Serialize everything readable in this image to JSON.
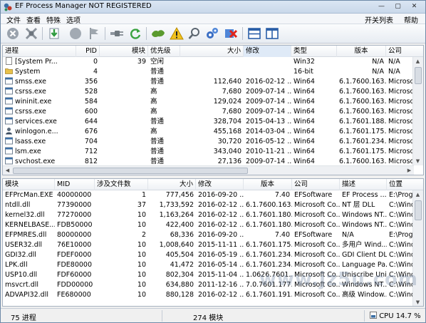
{
  "window": {
    "title": "EF Process Manager NOT REGISTERED",
    "controls": {
      "minimize": "—",
      "maximize": "▢",
      "close": "✕"
    }
  },
  "menu": {
    "file": "文件",
    "view": "查看",
    "special": "特殊",
    "options": "选项",
    "about": "开关列表",
    "help": "帮助"
  },
  "toolbar": {
    "icons": [
      "stop-icon",
      "kill-icon",
      "download-icon",
      "circle-icon",
      "flag-icon",
      "plug-icon",
      "refresh-icon",
      "map-icon",
      "warning-icon",
      "search-icon",
      "settings-icon",
      "error-icon",
      "layout-icon",
      "window-icon"
    ]
  },
  "processes": {
    "columns": [
      "进程",
      "PID",
      "模块",
      "优先级",
      "大小",
      "修改",
      "类型",
      "版本",
      "公司"
    ],
    "rows": [
      {
        "name": "[System Pr...",
        "pid": "0",
        "modules": "39",
        "priority": "空闲",
        "size": "",
        "modified": "",
        "type": "Win32",
        "version": "N/A",
        "company": "N/A",
        "icon": "blank"
      },
      {
        "name": "System",
        "pid": "4",
        "modules": "",
        "priority": "普通",
        "size": "",
        "modified": "",
        "type": "16-bit",
        "version": "N/A",
        "company": "N/A",
        "icon": "folder"
      },
      {
        "name": "smss.exe",
        "pid": "356",
        "modules": "",
        "priority": "普通",
        "size": "112,640",
        "modified": "2016-02-12 ...",
        "type": "Win64",
        "version": "6.1.7600.163...",
        "company": "Microsoft",
        "icon": "exe"
      },
      {
        "name": "csrss.exe",
        "pid": "528",
        "modules": "",
        "priority": "高",
        "size": "7,680",
        "modified": "2009-07-14 ...",
        "type": "Win64",
        "version": "6.1.7600.163...",
        "company": "Microsoft",
        "icon": "exe"
      },
      {
        "name": "wininit.exe",
        "pid": "584",
        "modules": "",
        "priority": "高",
        "size": "129,024",
        "modified": "2009-07-14 ...",
        "type": "Win64",
        "version": "6.1.7600.163...",
        "company": "Microsoft",
        "icon": "exe"
      },
      {
        "name": "csrss.exe",
        "pid": "600",
        "modules": "",
        "priority": "高",
        "size": "7,680",
        "modified": "2009-07-14 ...",
        "type": "Win64",
        "version": "6.1.7600.163...",
        "company": "Microsoft",
        "icon": "exe"
      },
      {
        "name": "services.exe",
        "pid": "644",
        "modules": "",
        "priority": "普通",
        "size": "328,704",
        "modified": "2015-04-13 ...",
        "type": "Win64",
        "version": "6.1.7601.188...",
        "company": "Microsoft",
        "icon": "exe"
      },
      {
        "name": "winlogon.e...",
        "pid": "676",
        "modules": "",
        "priority": "高",
        "size": "455,168",
        "modified": "2014-03-04 ...",
        "type": "Win64",
        "version": "6.1.7601.175...",
        "company": "Microsoft",
        "icon": "logon"
      },
      {
        "name": "lsass.exe",
        "pid": "704",
        "modules": "",
        "priority": "普通",
        "size": "30,720",
        "modified": "2016-05-12 ...",
        "type": "Win64",
        "version": "6.1.7601.234...",
        "company": "Microsoft",
        "icon": "exe"
      },
      {
        "name": "lsm.exe",
        "pid": "712",
        "modules": "",
        "priority": "普通",
        "size": "343,040",
        "modified": "2010-11-21 ...",
        "type": "Win64",
        "version": "6.1.7601.175...",
        "company": "Microsoft",
        "icon": "exe"
      },
      {
        "name": "svchost.exe",
        "pid": "812",
        "modules": "",
        "priority": "普通",
        "size": "27,136",
        "modified": "2009-07-14 ...",
        "type": "Win64",
        "version": "6.1.7600.163...",
        "company": "Microsoft",
        "icon": "exe"
      }
    ]
  },
  "modules": {
    "columns": [
      "模块",
      "MID",
      "涉及文件数",
      "大小",
      "修改",
      "版本",
      "公司",
      "描述",
      "位置"
    ],
    "rows": [
      {
        "name": "EFPrcMan.EXE",
        "mid": "40000000",
        "count": "1",
        "size": "777,456",
        "modified": "2016-09-20 ...",
        "version": "7.40",
        "company": "EFSoftware",
        "desc": "EF Process ...",
        "location": "E:\\Progra"
      },
      {
        "name": "ntdll.dll",
        "mid": "77390000",
        "count": "37",
        "size": "1,733,592",
        "modified": "2016-02-12 ...",
        "version": "6.1.7600.163...",
        "company": "Microsoft Co...",
        "desc": "NT 层 DLL",
        "location": "C:\\Window"
      },
      {
        "name": "kernel32.dll",
        "mid": "77270000",
        "count": "10",
        "size": "1,163,264",
        "modified": "2016-02-12 ...",
        "version": "6.1.7601.180...",
        "company": "Microsoft Co...",
        "desc": "Windows NT...",
        "location": "C:\\Window"
      },
      {
        "name": "KERNELBASE....",
        "mid": "FDB50000",
        "count": "10",
        "size": "422,400",
        "modified": "2016-02-12 ...",
        "version": "6.1.7601.180...",
        "company": "Microsoft Co...",
        "desc": "Windows NT...",
        "location": "C:\\Window"
      },
      {
        "name": "EFPMRES.dll",
        "mid": "80000000",
        "count": "2",
        "size": "68,336",
        "modified": "2016-09-20 ...",
        "version": "7.40",
        "company": "EFSoftware",
        "desc": "N/A",
        "location": "E:\\Progra"
      },
      {
        "name": "USER32.dll",
        "mid": "76E10000",
        "count": "10",
        "size": "1,008,640",
        "modified": "2015-11-11 ...",
        "version": "6.1.7601.175...",
        "company": "Microsoft Co...",
        "desc": "多用户 Wind...",
        "location": "C:\\Window"
      },
      {
        "name": "GDI32.dll",
        "mid": "FDEF0000",
        "count": "10",
        "size": "405,504",
        "modified": "2016-05-19 ...",
        "version": "6.1.7601.234...",
        "company": "Microsoft Co...",
        "desc": "GDI Client DLL",
        "location": "C:\\Window"
      },
      {
        "name": "LPK.dll",
        "mid": "FDE80000",
        "count": "10",
        "size": "41,472",
        "modified": "2016-05-14 ...",
        "version": "6.1.7601.234...",
        "company": "Microsoft Co...",
        "desc": "Language Pa...",
        "location": "C:\\Window"
      },
      {
        "name": "USP10.dll",
        "mid": "FDF60000",
        "count": "10",
        "size": "802,304",
        "modified": "2015-11-04 ...",
        "version": "1.0626.7601...",
        "company": "Microsoft Co...",
        "desc": "Uniscribe Uni...",
        "location": "C:\\Window"
      },
      {
        "name": "msvcrt.dll",
        "mid": "FDD00000",
        "count": "10",
        "size": "634,880",
        "modified": "2011-12-16 ...",
        "version": "7.0.7601.177...",
        "company": "Microsoft Co...",
        "desc": "Windows NT...",
        "location": "C:\\Window"
      },
      {
        "name": "ADVAPI32.dll",
        "mid": "FE680000",
        "count": "10",
        "size": "880,128",
        "modified": "2016-02-12 ...",
        "version": "6.1.7601.191...",
        "company": "Microsoft Co...",
        "desc": "高级 Window...",
        "location": "C:\\Window"
      }
    ]
  },
  "status": {
    "processes": "75 进程",
    "modules": "274 模块",
    "cpu": "CPU 14.7 %"
  },
  "watermark": "www.jz5u.com",
  "colors": {
    "accent": "#3a6ea5",
    "selectedHeader": "#dfeaf7"
  }
}
